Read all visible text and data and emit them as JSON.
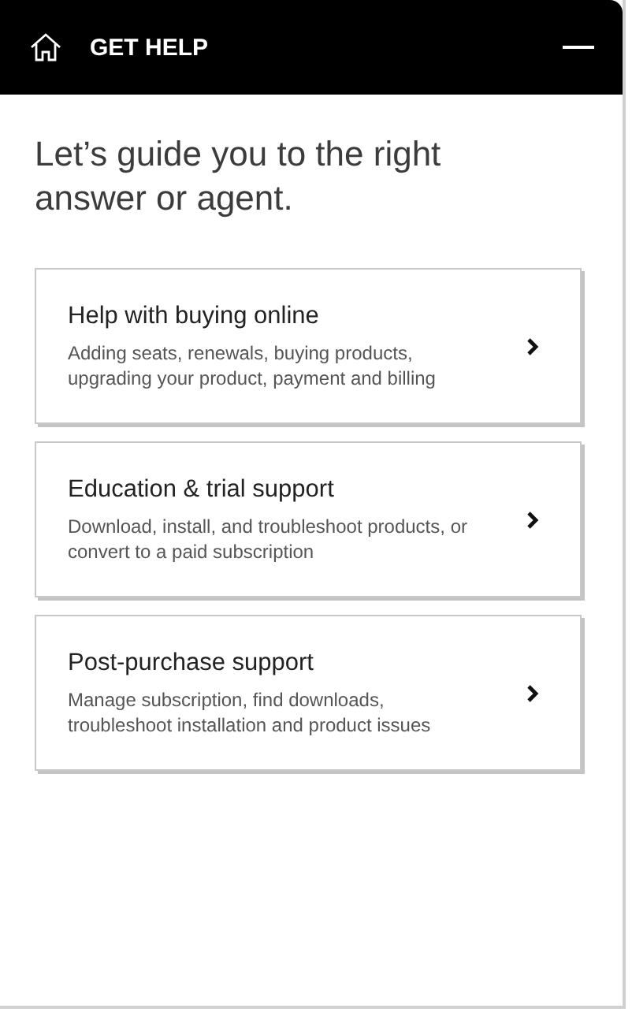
{
  "header": {
    "title": "GET HELP"
  },
  "heading": "Let’s guide you to the right answer or agent.",
  "options": [
    {
      "title": "Help with buying online",
      "description": "Adding seats, renewals, buying products, upgrading your product, payment and billing"
    },
    {
      "title": "Education & trial support",
      "description": "Download, install, and troubleshoot products, or convert to a paid subscription"
    },
    {
      "title": "Post-purchase support",
      "description": "Manage subscription, find downloads, troubleshoot installation and product issues"
    }
  ]
}
